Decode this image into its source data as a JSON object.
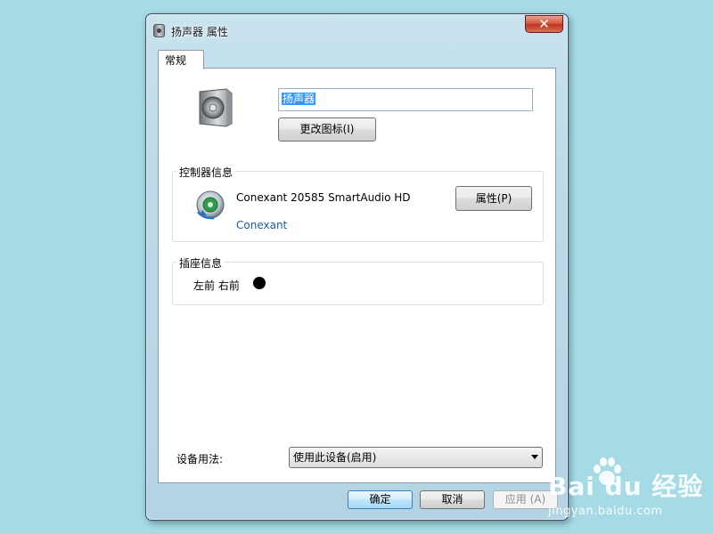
{
  "window": {
    "title": "扬声器 属性",
    "close_label": "✕"
  },
  "tabs": [
    {
      "label": "常规"
    }
  ],
  "general": {
    "device_name": "扬声器",
    "change_icon_label": "更改图标(I)"
  },
  "controller": {
    "group_label": "控制器信息",
    "name": "Conexant 20585 SmartAudio HD",
    "vendor": "Conexant",
    "properties_label": "属性(P)"
  },
  "jack": {
    "group_label": "插座信息",
    "text": "左前 右前",
    "color": "#000000"
  },
  "usage": {
    "label": "设备用法:",
    "selected": "使用此设备(启用)"
  },
  "footer": {
    "ok_label": "确定",
    "cancel_label": "取消",
    "apply_label": "应用 (A)"
  },
  "watermark": {
    "main": "Bai du 经验",
    "sub": "jingyan.baidu.com"
  },
  "colors": {
    "desktop": "#a6dbe6",
    "link": "#1e5ba6",
    "selection": "#3399ff",
    "close": "#c0351b"
  }
}
